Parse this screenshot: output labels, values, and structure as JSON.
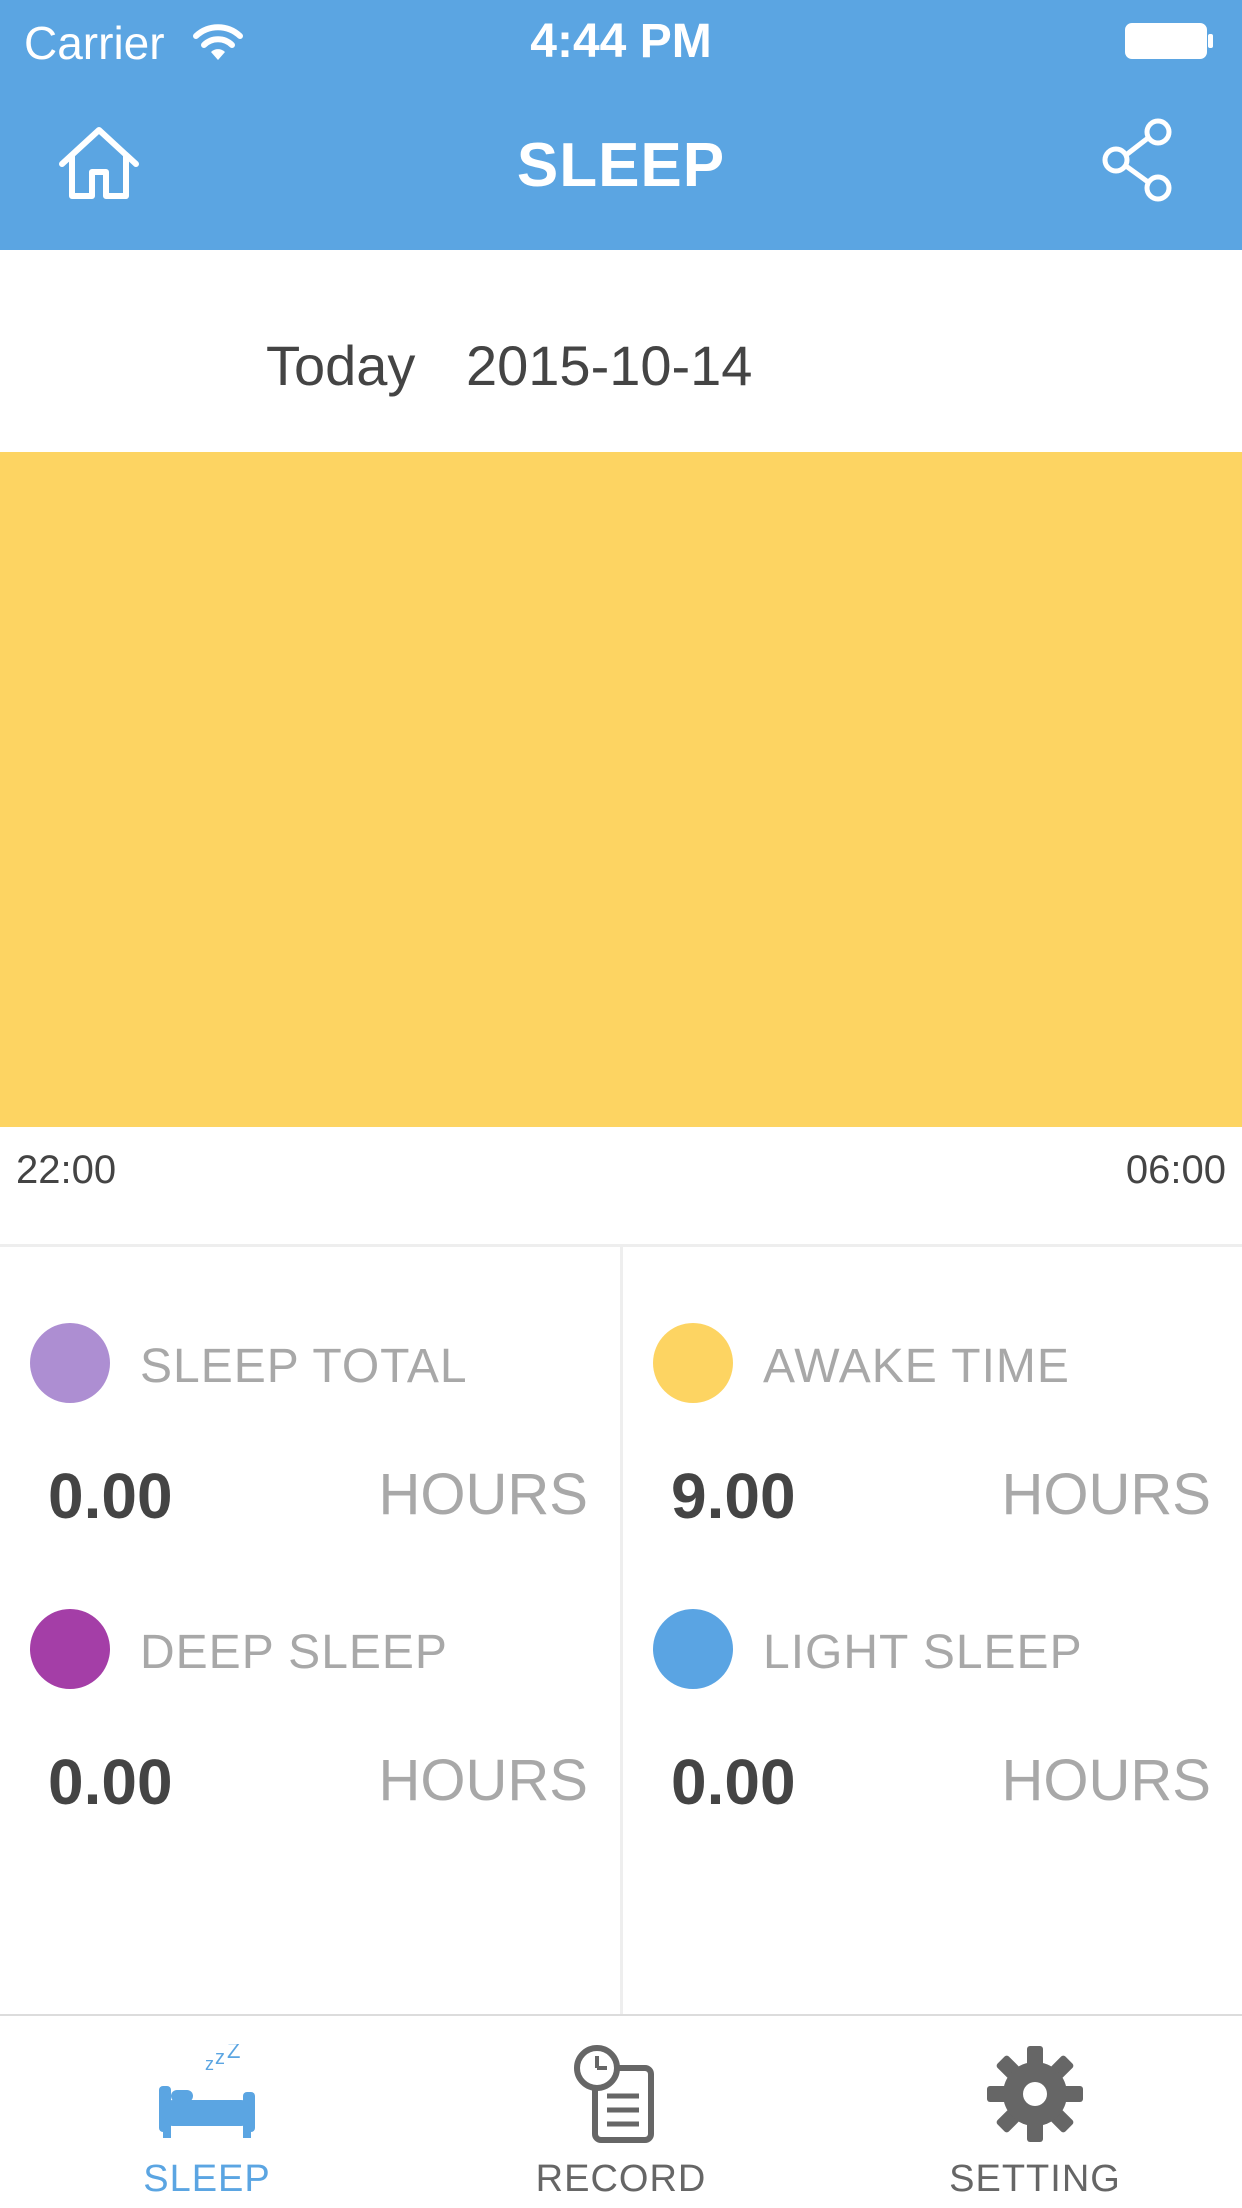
{
  "status_bar": {
    "carrier": "Carrier",
    "time": "4:44 PM"
  },
  "header": {
    "title": "SLEEP",
    "home_icon": "home-icon",
    "share_icon": "share-icon",
    "bar_color": "#5ba5e2"
  },
  "date": {
    "label": "Today",
    "value": "2015-10-14"
  },
  "chart_data": {
    "type": "area",
    "x_start": "22:00",
    "x_end": "06:00",
    "segments": [
      {
        "state": "AWAKE TIME",
        "from": "22:00",
        "to": "06:00",
        "color": "#fdd462"
      }
    ]
  },
  "stats": [
    {
      "label": "SLEEP TOTAL",
      "value": "0.00",
      "unit": "HOURS",
      "color": "#ad8ed2"
    },
    {
      "label": "AWAKE TIME",
      "value": "9.00",
      "unit": "HOURS",
      "color": "#fdd462"
    },
    {
      "label": "DEEP SLEEP",
      "value": "0.00",
      "unit": "HOURS",
      "color": "#a43ea7"
    },
    {
      "label": "LIGHT SLEEP",
      "value": "0.00",
      "unit": "HOURS",
      "color": "#5aa4e3"
    }
  ],
  "tabs": [
    {
      "label": "SLEEP",
      "icon": "bed-icon",
      "active": true,
      "color": "#5ba5e2"
    },
    {
      "label": "RECORD",
      "icon": "record-clipboard-icon",
      "active": false,
      "color": "#666666"
    },
    {
      "label": "SETTING",
      "icon": "gear-icon",
      "active": false,
      "color": "#666666"
    }
  ]
}
